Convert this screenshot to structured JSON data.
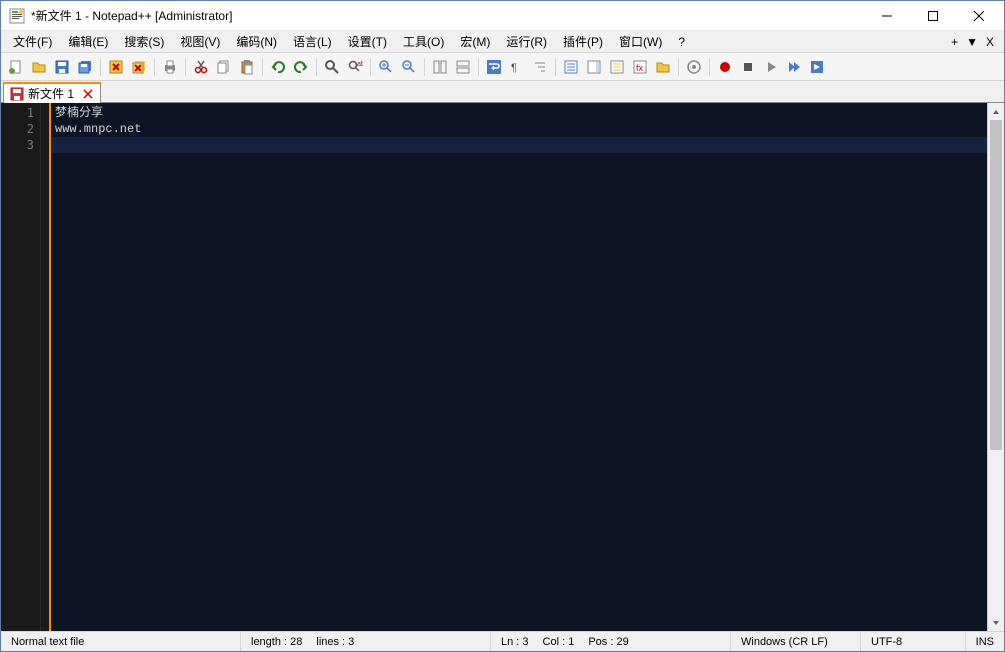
{
  "window": {
    "title": "*新文件 1 - Notepad++ [Administrator]"
  },
  "menu": {
    "file": "文件(F)",
    "edit": "编辑(E)",
    "search": "搜索(S)",
    "view": "视图(V)",
    "encoding": "编码(N)",
    "language": "语言(L)",
    "settings": "设置(T)",
    "tools": "工具(O)",
    "macro": "宏(M)",
    "run": "运行(R)",
    "plugins": "插件(P)",
    "window": "窗口(W)",
    "help": "?",
    "extra_plus": "+",
    "extra_down": "▼",
    "extra_x": "X"
  },
  "tabs": [
    {
      "label": "新文件 1"
    }
  ],
  "editor": {
    "lines": [
      "梦楠分享",
      "www.mnpc.net",
      ""
    ],
    "line_numbers": [
      "1",
      "2",
      "3"
    ]
  },
  "status": {
    "filetype": "Normal text file",
    "length": "length : 28",
    "lines": "lines : 3",
    "ln": "Ln : 3",
    "col": "Col : 1",
    "pos": "Pos : 29",
    "eol": "Windows (CR LF)",
    "encoding": "UTF-8",
    "mode": "INS"
  }
}
